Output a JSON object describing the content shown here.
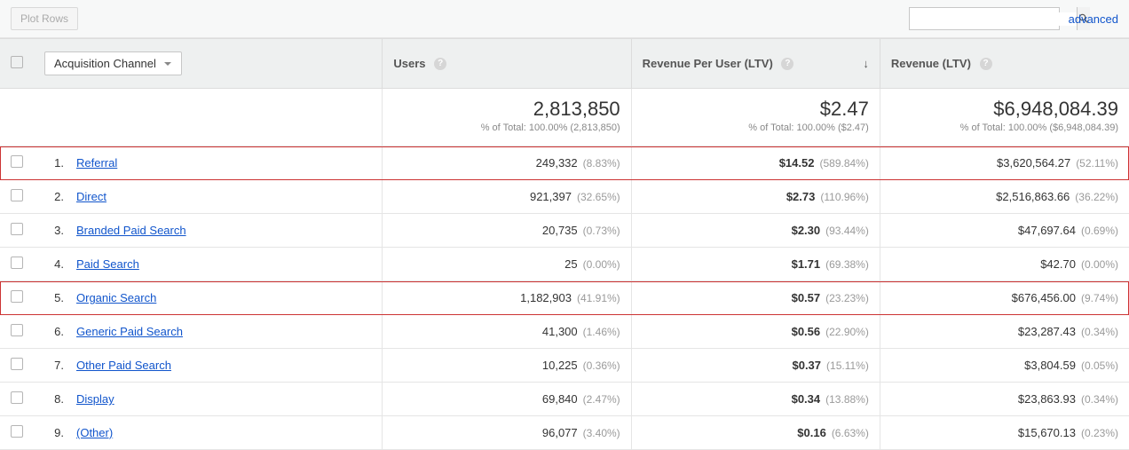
{
  "toolbar": {
    "plot_rows": "Plot Rows",
    "search_placeholder": "",
    "advanced": "advanced"
  },
  "header": {
    "checkbox": "",
    "dimension_label": "Acquisition Channel",
    "metrics": [
      {
        "label": "Users",
        "sorted": false
      },
      {
        "label": "Revenue Per User (LTV)",
        "sorted": true
      },
      {
        "label": "Revenue (LTV)",
        "sorted": false
      }
    ]
  },
  "totals": [
    {
      "value": "2,813,850",
      "sub": "% of Total: 100.00% (2,813,850)"
    },
    {
      "value": "$2.47",
      "sub": "% of Total: 100.00% ($2.47)"
    },
    {
      "value": "$6,948,084.39",
      "sub": "% of Total: 100.00% ($6,948,084.39)"
    }
  ],
  "rows": [
    {
      "rank": "1.",
      "name": "Referral",
      "highlight": true,
      "users": "249,332",
      "users_pct": "(8.83%)",
      "rpu": "$14.52",
      "rpu_pct": "(589.84%)",
      "rev": "$3,620,564.27",
      "rev_pct": "(52.11%)"
    },
    {
      "rank": "2.",
      "name": "Direct",
      "highlight": false,
      "users": "921,397",
      "users_pct": "(32.65%)",
      "rpu": "$2.73",
      "rpu_pct": "(110.96%)",
      "rev": "$2,516,863.66",
      "rev_pct": "(36.22%)"
    },
    {
      "rank": "3.",
      "name": "Branded Paid Search",
      "highlight": false,
      "users": "20,735",
      "users_pct": "(0.73%)",
      "rpu": "$2.30",
      "rpu_pct": "(93.44%)",
      "rev": "$47,697.64",
      "rev_pct": "(0.69%)"
    },
    {
      "rank": "4.",
      "name": "Paid Search",
      "highlight": false,
      "users": "25",
      "users_pct": "(0.00%)",
      "rpu": "$1.71",
      "rpu_pct": "(69.38%)",
      "rev": "$42.70",
      "rev_pct": "(0.00%)"
    },
    {
      "rank": "5.",
      "name": "Organic Search",
      "highlight": true,
      "users": "1,182,903",
      "users_pct": "(41.91%)",
      "rpu": "$0.57",
      "rpu_pct": "(23.23%)",
      "rev": "$676,456.00",
      "rev_pct": "(9.74%)"
    },
    {
      "rank": "6.",
      "name": "Generic Paid Search",
      "highlight": false,
      "users": "41,300",
      "users_pct": "(1.46%)",
      "rpu": "$0.56",
      "rpu_pct": "(22.90%)",
      "rev": "$23,287.43",
      "rev_pct": "(0.34%)"
    },
    {
      "rank": "7.",
      "name": "Other Paid Search",
      "highlight": false,
      "users": "10,225",
      "users_pct": "(0.36%)",
      "rpu": "$0.37",
      "rpu_pct": "(15.11%)",
      "rev": "$3,804.59",
      "rev_pct": "(0.05%)"
    },
    {
      "rank": "8.",
      "name": "Display",
      "highlight": false,
      "users": "69,840",
      "users_pct": "(2.47%)",
      "rpu": "$0.34",
      "rpu_pct": "(13.88%)",
      "rev": "$23,863.93",
      "rev_pct": "(0.34%)"
    },
    {
      "rank": "9.",
      "name": "(Other)",
      "highlight": false,
      "users": "96,077",
      "users_pct": "(3.40%)",
      "rpu": "$0.16",
      "rpu_pct": "(6.63%)",
      "rev": "$15,670.13",
      "rev_pct": "(0.23%)"
    }
  ]
}
